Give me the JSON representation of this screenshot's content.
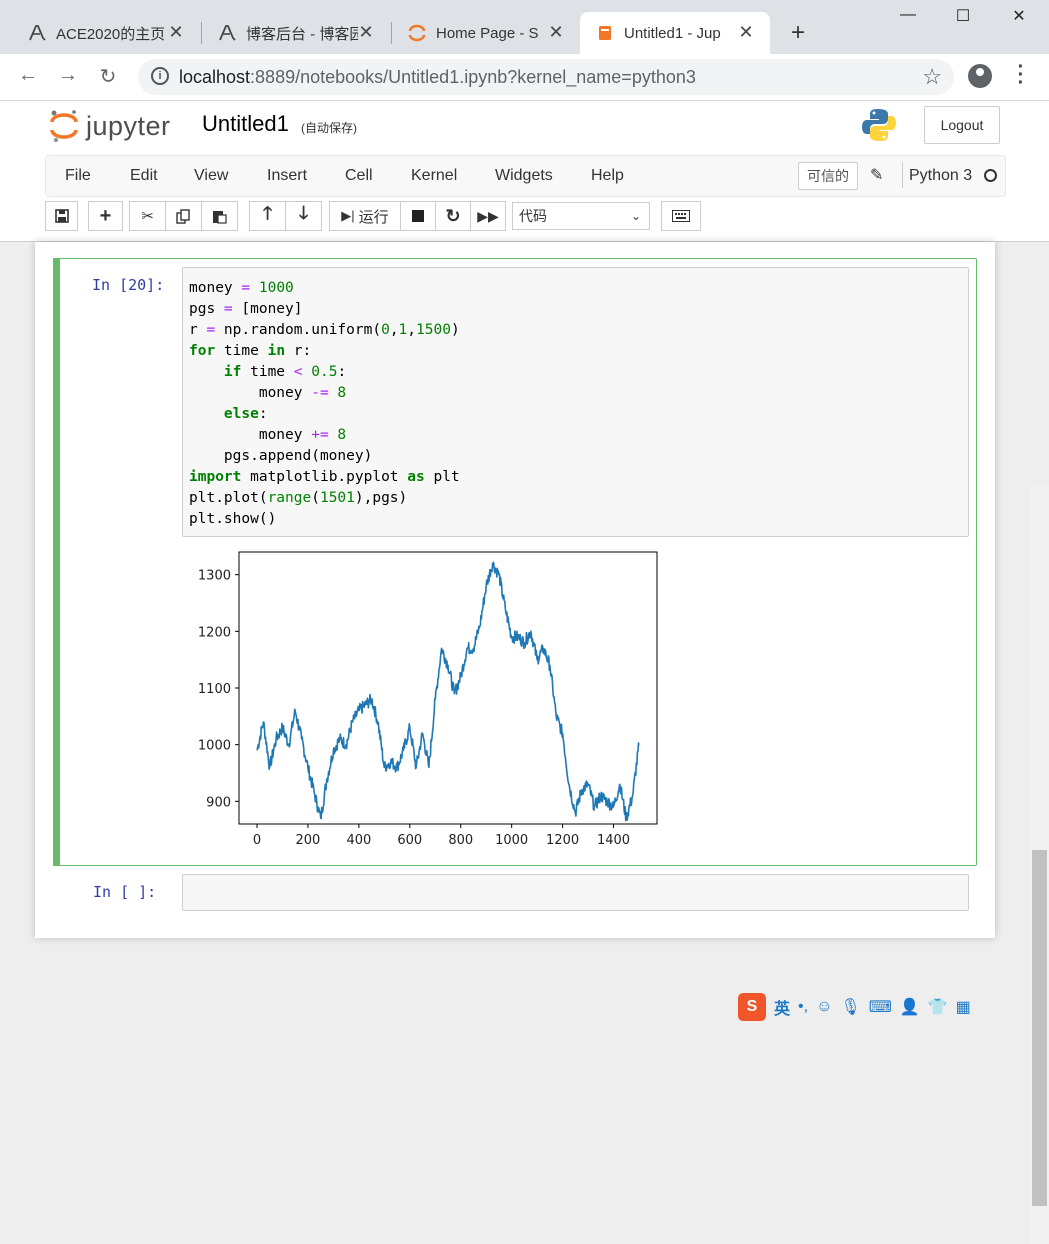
{
  "browser": {
    "tabs": [
      {
        "label": "ACE2020的主页",
        "icon": "ace-icon"
      },
      {
        "label": "博客后台 - 博客园",
        "icon": "ace-icon"
      },
      {
        "label": "Home Page - S",
        "icon": "jupyter-ring-icon"
      },
      {
        "label": "Untitled1 - Jup",
        "icon": "notebook-icon"
      }
    ],
    "active_tab": 3,
    "url_host": "localhost",
    "url_path": ":8889/notebooks/Untitled1.ipynb?kernel_name=python3"
  },
  "jupyter": {
    "logo_text": "jupyter",
    "notebook_name": "Untitled1",
    "autosave": "(自动保存)",
    "logout": "Logout",
    "menu": [
      "File",
      "Edit",
      "View",
      "Insert",
      "Cell",
      "Kernel",
      "Widgets",
      "Help"
    ],
    "trusted": "可信的",
    "kernel": "Python 3",
    "run_label": "运行",
    "cell_type": "代码"
  },
  "cells": {
    "cell1_prompt": "In  [20]:",
    "cell2_prompt": "In  [ ]:"
  },
  "chart_data": {
    "type": "line",
    "xlim": [
      0,
      1500
    ],
    "ylim": [
      860,
      1340
    ],
    "xticks": [
      0,
      200,
      400,
      600,
      800,
      1000,
      1200,
      1400
    ],
    "yticks": [
      900,
      1000,
      1100,
      1200,
      1300
    ],
    "color": "#1f77b4",
    "x": [
      0,
      25,
      50,
      75,
      100,
      125,
      150,
      175,
      200,
      225,
      250,
      275,
      300,
      325,
      350,
      375,
      400,
      425,
      450,
      475,
      500,
      525,
      550,
      575,
      600,
      625,
      650,
      675,
      700,
      725,
      750,
      775,
      800,
      825,
      850,
      875,
      900,
      925,
      950,
      975,
      1000,
      1025,
      1050,
      1075,
      1100,
      1125,
      1150,
      1175,
      1200,
      1225,
      1250,
      1275,
      1300,
      1325,
      1350,
      1375,
      1400,
      1425,
      1450,
      1475,
      1500
    ],
    "values": [
      990,
      1040,
      960,
      1010,
      1030,
      1000,
      1060,
      1010,
      960,
      915,
      870,
      940,
      990,
      1010,
      1000,
      1040,
      1060,
      1070,
      1080,
      1040,
      960,
      970,
      960,
      990,
      1030,
      960,
      1020,
      960,
      1080,
      1170,
      1140,
      1090,
      1120,
      1170,
      1170,
      1210,
      1280,
      1320,
      1300,
      1240,
      1190,
      1190,
      1180,
      1200,
      1150,
      1170,
      1140,
      1050,
      1020,
      930,
      880,
      920,
      930,
      890,
      910,
      900,
      890,
      930,
      870,
      910,
      1000
    ]
  }
}
